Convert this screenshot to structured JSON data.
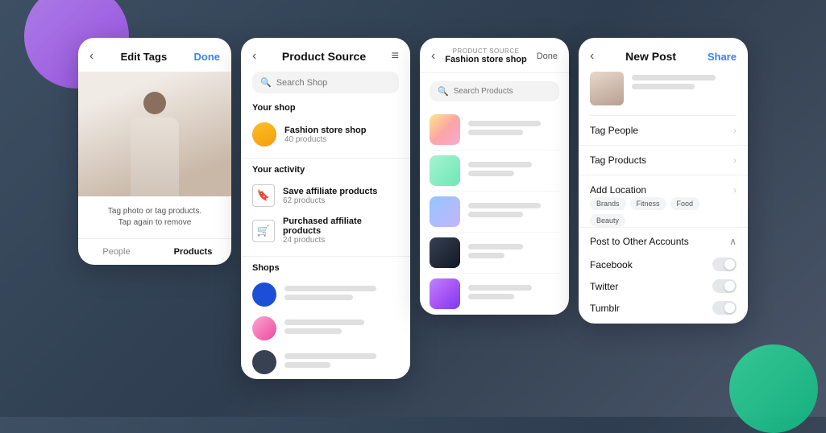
{
  "decorative": {
    "top_circle_color": "#a855f7",
    "bottom_circle_color": "#10b981"
  },
  "panel1": {
    "title": "Edit Tags",
    "done_label": "Done",
    "back_icon": "‹",
    "instruction_line1": "Tag photo or tag products.",
    "instruction_line2": "Tap again to remove",
    "tab_people": "People",
    "tab_products": "Products"
  },
  "panel2": {
    "title": "Product Source",
    "back_icon": "‹",
    "menu_icon": "≡",
    "search_placeholder": "Search Shop",
    "your_shop_label": "Your shop",
    "shop_name": "Fashion store shop",
    "shop_count": "40 products",
    "your_activity_label": "Your activity",
    "activity1_name": "Save affiliate products",
    "activity1_count": "62 products",
    "activity2_name": "Purchased affiliate products",
    "activity2_count": "24 products",
    "shops_label": "Shops"
  },
  "panel3": {
    "subtitle": "PRODUCT SOURCE",
    "title": "Fashion store shop",
    "done_label": "Done",
    "back_icon": "‹",
    "search_placeholder": "Search Products",
    "products": [
      {
        "id": 1
      },
      {
        "id": 2
      },
      {
        "id": 3
      },
      {
        "id": 4
      },
      {
        "id": 5
      }
    ]
  },
  "panel4": {
    "title": "New Post",
    "share_label": "Share",
    "back_icon": "‹",
    "option_tag_people": "Tag People",
    "option_tag_products": "Tag Products",
    "option_add_location": "Add Location",
    "location_tags": [
      "Brands",
      "Fitness",
      "Food",
      "Beauty"
    ],
    "other_accounts_label": "Post to Other Accounts",
    "socials": [
      {
        "name": "Facebook"
      },
      {
        "name": "Twitter"
      },
      {
        "name": "Tumblr"
      }
    ],
    "chevron_right": "›",
    "chevron_up": "∧"
  }
}
